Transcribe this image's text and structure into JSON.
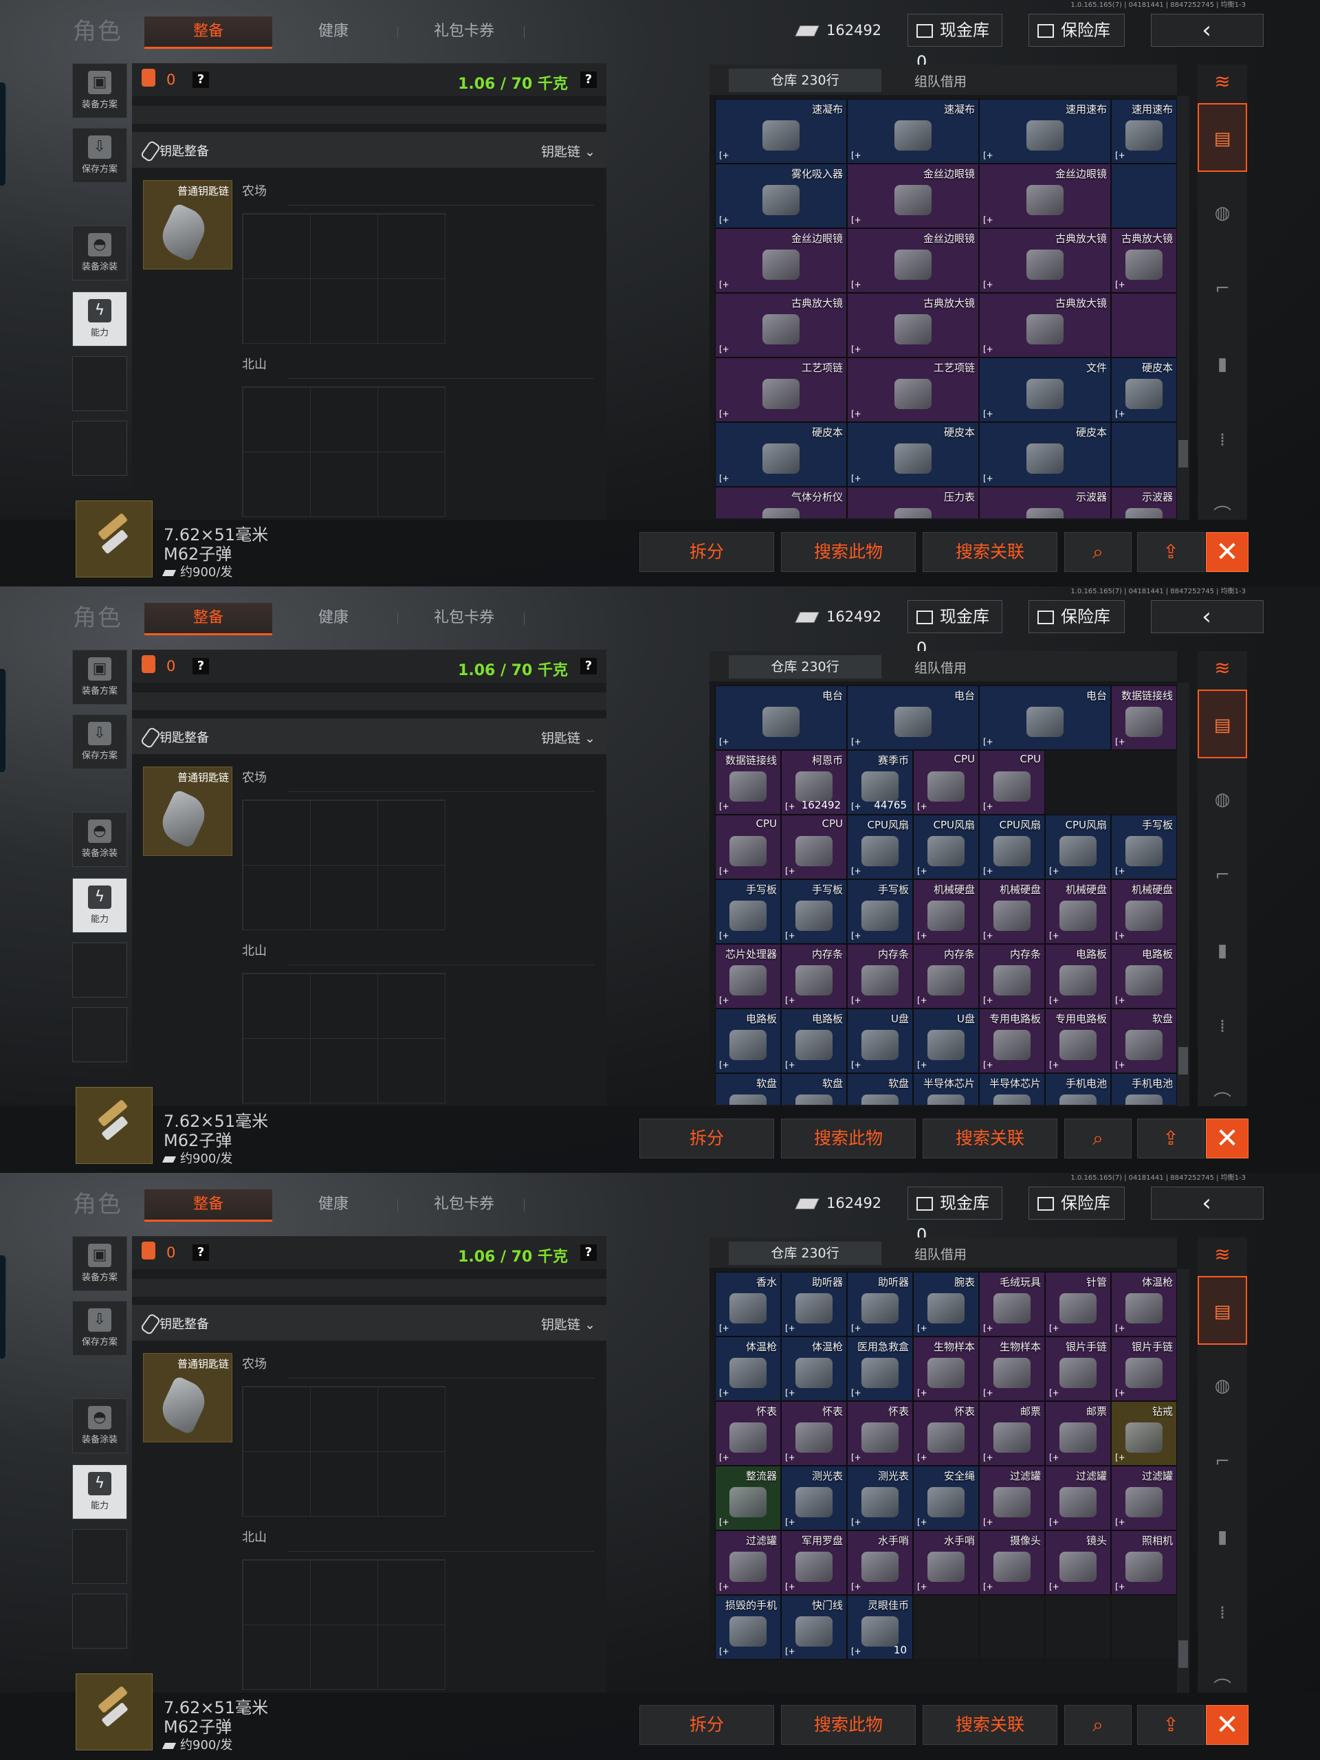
{
  "version": "1.0.165.165(7) | 04181441 | 8847252745 | 均衡1-3",
  "header": {
    "role_title": "角色",
    "tabs": [
      "整备",
      "健康",
      "礼包卡券"
    ],
    "money": "162492",
    "cash_vault": "现金库 0",
    "safe_vault": "保险库",
    "back_icon": "‹"
  },
  "left_rail": [
    {
      "label": "装备方案",
      "icon": "vest-icon"
    },
    {
      "label": "保存方案",
      "icon": "download-icon"
    },
    {
      "label": "装备涂装",
      "icon": "helmet-icon"
    },
    {
      "label": "能力",
      "icon": "ability-icon"
    }
  ],
  "gear": {
    "bag_count": "0",
    "help": "?",
    "weight": "1.06 / 70 千克",
    "keychain_title": "钥匙整备",
    "keychain_select": "钥匙链",
    "key_item": "普通钥匙链",
    "zones": [
      "农场",
      "北山"
    ]
  },
  "inventory": {
    "tab_warehouse": "仓库 230行",
    "tab_team": "组队借用",
    "panels": [
      {
        "rows": [
          [
            {
              "n": "速凝布",
              "c": "navy"
            },
            {
              "n": "速凝布",
              "c": "navy"
            },
            {
              "n": "速用速布",
              "c": "navy"
            },
            {
              "n": "速用速布",
              "c": "navy"
            }
          ],
          [
            {
              "n": "雾化吸入器",
              "c": "navy"
            },
            {
              "n": "金丝边眼镜",
              "c": "purple"
            },
            {
              "n": "金丝边眼镜",
              "c": "purple"
            },
            {
              "n": "",
              "c": "navy"
            }
          ],
          [
            {
              "n": "金丝边眼镜",
              "c": "purple"
            },
            {
              "n": "金丝边眼镜",
              "c": "purple"
            },
            {
              "n": "古典放大镜",
              "c": "purple"
            },
            {
              "n": "古典放大镜",
              "c": "purple"
            }
          ],
          [
            {
              "n": "古典放大镜",
              "c": "purple"
            },
            {
              "n": "古典放大镜",
              "c": "purple"
            },
            {
              "n": "古典放大镜",
              "c": "purple"
            },
            {
              "n": "",
              "c": "purple"
            }
          ],
          [
            {
              "n": "工艺项链",
              "c": "purple"
            },
            {
              "n": "工艺项链",
              "c": "purple"
            },
            {
              "n": "文件",
              "c": "navy"
            },
            {
              "n": "硬皮本",
              "c": "navy"
            }
          ],
          [
            {
              "n": "硬皮本",
              "c": "navy"
            },
            {
              "n": "硬皮本",
              "c": "navy"
            },
            {
              "n": "硬皮本",
              "c": "navy"
            },
            {
              "n": "",
              "c": "navy"
            }
          ],
          [
            {
              "n": "气体分析仪",
              "c": "purple"
            },
            {
              "n": "压力表",
              "c": "purple"
            },
            {
              "n": "示波器",
              "c": "purple"
            },
            {
              "n": "示波器",
              "c": "purple"
            }
          ]
        ]
      },
      {
        "rows": [
          [
            {
              "n": "电台",
              "c": "navy"
            },
            {
              "n": "电台",
              "c": "navy"
            },
            {
              "n": "电台",
              "c": "navy"
            },
            {
              "n": "数据链接线",
              "c": "purple"
            }
          ],
          [
            {
              "n": "数据链接线",
              "c": "purple"
            },
            {
              "n": "柯恩币",
              "c": "purple",
              "q": "162492"
            },
            {
              "n": "赛季币",
              "c": "navy",
              "q": "44765"
            },
            {
              "n": "CPU",
              "c": "purple"
            },
            {
              "n": "CPU",
              "c": "purple"
            }
          ],
          [
            {
              "n": "CPU",
              "c": "purple"
            },
            {
              "n": "CPU",
              "c": "purple"
            },
            {
              "n": "CPU风扇",
              "c": "navy"
            },
            {
              "n": "CPU风扇",
              "c": "navy"
            },
            {
              "n": "CPU风扇",
              "c": "navy"
            },
            {
              "n": "CPU风扇",
              "c": "navy"
            },
            {
              "n": "手写板",
              "c": "navy"
            }
          ],
          [
            {
              "n": "手写板",
              "c": "navy"
            },
            {
              "n": "手写板",
              "c": "navy"
            },
            {
              "n": "手写板",
              "c": "navy"
            },
            {
              "n": "机械硬盘",
              "c": "purple"
            },
            {
              "n": "机械硬盘",
              "c": "purple"
            },
            {
              "n": "机械硬盘",
              "c": "purple"
            },
            {
              "n": "机械硬盘",
              "c": "purple"
            }
          ],
          [
            {
              "n": "芯片处理器",
              "c": "purple"
            },
            {
              "n": "内存条",
              "c": "purple"
            },
            {
              "n": "内存条",
              "c": "purple"
            },
            {
              "n": "内存条",
              "c": "purple"
            },
            {
              "n": "内存条",
              "c": "purple"
            },
            {
              "n": "电路板",
              "c": "purple"
            },
            {
              "n": "电路板",
              "c": "purple"
            }
          ],
          [
            {
              "n": "电路板",
              "c": "navy"
            },
            {
              "n": "电路板",
              "c": "navy"
            },
            {
              "n": "U盘",
              "c": "navy"
            },
            {
              "n": "U盘",
              "c": "navy"
            },
            {
              "n": "专用电路板",
              "c": "purple"
            },
            {
              "n": "专用电路板",
              "c": "purple"
            },
            {
              "n": "软盘",
              "c": "purple"
            }
          ],
          [
            {
              "n": "软盘",
              "c": "navy"
            },
            {
              "n": "软盘",
              "c": "navy"
            },
            {
              "n": "软盘",
              "c": "navy"
            },
            {
              "n": "半导体芯片",
              "c": "navy"
            },
            {
              "n": "半导体芯片",
              "c": "navy"
            },
            {
              "n": "手机电池",
              "c": "navy"
            },
            {
              "n": "手机电池",
              "c": "navy"
            }
          ]
        ]
      },
      {
        "rows": [
          [
            {
              "n": "香水",
              "c": "navy"
            },
            {
              "n": "助听器",
              "c": "navy"
            },
            {
              "n": "助听器",
              "c": "navy"
            },
            {
              "n": "腕表",
              "c": "navy"
            },
            {
              "n": "毛绒玩具",
              "c": "purple"
            },
            {
              "n": "针管",
              "c": "purple"
            },
            {
              "n": "体温枪",
              "c": "purple"
            }
          ],
          [
            {
              "n": "体温枪",
              "c": "navy"
            },
            {
              "n": "体温枪",
              "c": "navy"
            },
            {
              "n": "医用急救盒",
              "c": "navy"
            },
            {
              "n": "生物样本",
              "c": "purple"
            },
            {
              "n": "生物样本",
              "c": "purple"
            },
            {
              "n": "银片手链",
              "c": "purple"
            },
            {
              "n": "银片手链",
              "c": "purple"
            }
          ],
          [
            {
              "n": "怀表",
              "c": "purple"
            },
            {
              "n": "怀表",
              "c": "purple"
            },
            {
              "n": "怀表",
              "c": "purple"
            },
            {
              "n": "怀表",
              "c": "purple"
            },
            {
              "n": "邮票",
              "c": "purple"
            },
            {
              "n": "邮票",
              "c": "purple"
            },
            {
              "n": "钻戒",
              "c": "gold"
            }
          ],
          [
            {
              "n": "整流器",
              "c": "green"
            },
            {
              "n": "测光表",
              "c": "navy"
            },
            {
              "n": "测光表",
              "c": "navy"
            },
            {
              "n": "安全绳",
              "c": "navy"
            },
            {
              "n": "过滤罐",
              "c": "purple"
            },
            {
              "n": "过滤罐",
              "c": "purple"
            },
            {
              "n": "过滤罐",
              "c": "purple"
            }
          ],
          [
            {
              "n": "过滤罐",
              "c": "purple"
            },
            {
              "n": "军用罗盘",
              "c": "purple"
            },
            {
              "n": "水手哨",
              "c": "purple"
            },
            {
              "n": "水手哨",
              "c": "purple"
            },
            {
              "n": "摄像头",
              "c": "purple"
            },
            {
              "n": "镜头",
              "c": "purple"
            },
            {
              "n": "照相机",
              "c": "purple"
            }
          ],
          [
            {
              "n": "损毁的手机",
              "c": "navy"
            },
            {
              "n": "快门线",
              "c": "navy"
            },
            {
              "n": "灵眼佳币",
              "c": "navy",
              "q": "10"
            },
            {
              "n": "",
              "c": "empty"
            },
            {
              "n": "",
              "c": "empty"
            },
            {
              "n": "",
              "c": "empty"
            },
            {
              "n": "",
              "c": "empty"
            }
          ]
        ]
      }
    ]
  },
  "bottom": {
    "ammo_name": "7.62×51毫米",
    "ammo_sub": "M62子弹",
    "ammo_price": "约900/发",
    "btn_split": "拆分",
    "btn_search": "搜索此物",
    "btn_link": "搜索关联",
    "btn_mag_icon": "⌕",
    "btn_share_icon": "⇪",
    "btn_close_icon": "✕"
  },
  "colors": {
    "accent": "#ff5a1f",
    "weight": "#7ee12c",
    "purple": "#3a1f48",
    "navy": "#17284a",
    "green": "#1f3c23",
    "gold": "#4a3f1c"
  }
}
